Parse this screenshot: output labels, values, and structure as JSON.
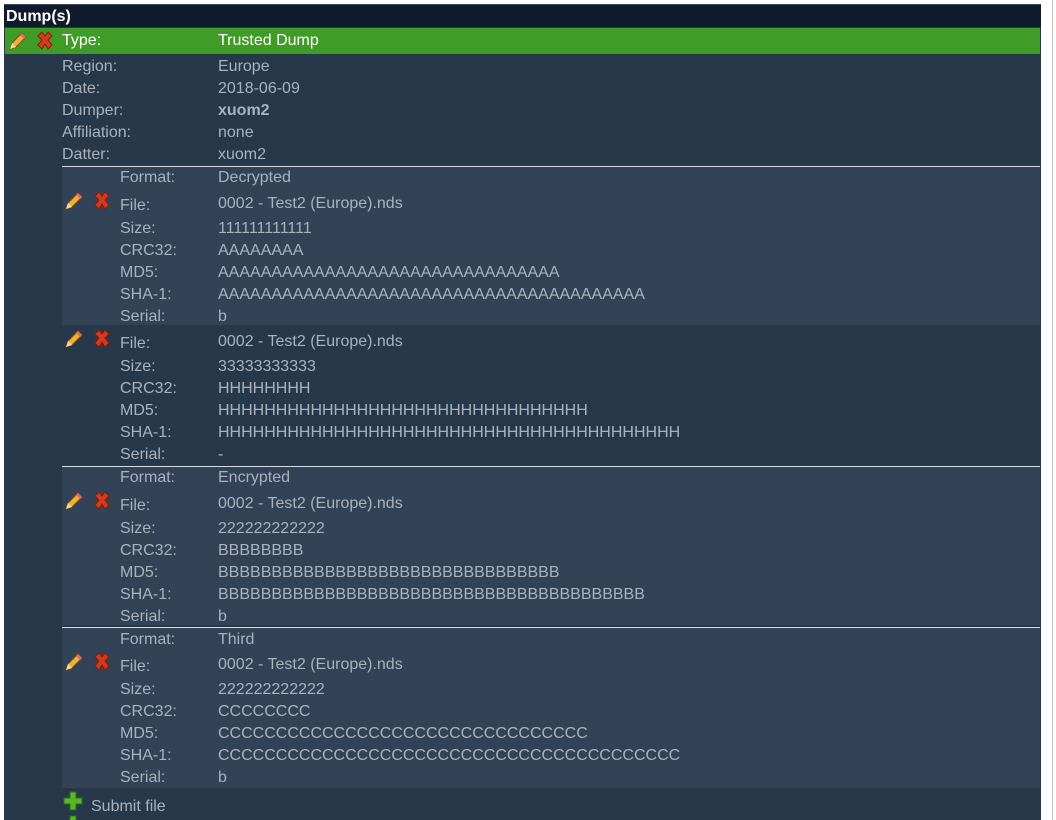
{
  "section_title": "Dump(s)",
  "dump": {
    "type_label": "Type:",
    "type_value": "Trusted Dump",
    "meta": [
      {
        "label": "Region:",
        "value": "Europe"
      },
      {
        "label": "Date:",
        "value": "2018-06-09"
      },
      {
        "label": "Dumper:",
        "value": "xuom2"
      },
      {
        "label": "Affiliation:",
        "value": "none"
      },
      {
        "label": "Datter:",
        "value": "xuom2"
      }
    ]
  },
  "groups": [
    {
      "format_label": "Format:",
      "format_value": "Decrypted",
      "files": [
        {
          "file_label": "File:",
          "file": "0002 - Test2 (Europe).nds",
          "size_label": "Size:",
          "size": "111111111111",
          "crc_label": "CRC32:",
          "crc32": "AAAAAAAA",
          "md5_label": "MD5:",
          "md5": "AAAAAAAAAAAAAAAAAAAAAAAAAAAAAAAA",
          "sha_label": "SHA-1:",
          "sha1": "AAAAAAAAAAAAAAAAAAAAAAAAAAAAAAAAAAAAAAAA",
          "serial_label": "Serial:",
          "serial": "b"
        },
        {
          "file_label": "File:",
          "file": "0002 - Test2 (Europe).nds",
          "size_label": "Size:",
          "size": "33333333333",
          "crc_label": "CRC32:",
          "crc32": "HHHHHHHH",
          "md5_label": "MD5:",
          "md5": "HHHHHHHHHHHHHHHHHHHHHHHHHHHHHHHH",
          "sha_label": "SHA-1:",
          "sha1": "HHHHHHHHHHHHHHHHHHHHHHHHHHHHHHHHHHHHHHHH",
          "serial_label": "Serial:",
          "serial": "-"
        }
      ]
    },
    {
      "format_label": "Format:",
      "format_value": "Encrypted",
      "files": [
        {
          "file_label": "File:",
          "file": "0002 - Test2 (Europe).nds",
          "size_label": "Size:",
          "size": "222222222222",
          "crc_label": "CRC32:",
          "crc32": "BBBBBBBB",
          "md5_label": "MD5:",
          "md5": "BBBBBBBBBBBBBBBBBBBBBBBBBBBBBBBB",
          "sha_label": "SHA-1:",
          "sha1": "BBBBBBBBBBBBBBBBBBBBBBBBBBBBBBBBBBBBBBBB",
          "serial_label": "Serial:",
          "serial": "b"
        }
      ]
    },
    {
      "format_label": "Format:",
      "format_value": "Third",
      "files": [
        {
          "file_label": "File:",
          "file": "0002 - Test2 (Europe).nds",
          "size_label": "Size:",
          "size": "222222222222",
          "crc_label": "CRC32:",
          "crc32": "CCCCCCCC",
          "md5_label": "MD5:",
          "md5": "CCCCCCCCCCCCCCCCCCCCCCCCCCCCCCCC",
          "sha_label": "SHA-1:",
          "sha1": "CCCCCCCCCCCCCCCCCCCCCCCCCCCCCCCCCCCCCCCC",
          "serial_label": "Serial:",
          "serial": "b"
        }
      ]
    }
  ],
  "submit_label": "Submit file",
  "icons": {
    "edit": "pencil-icon",
    "delete": "red-x-icon",
    "add": "green-plus-icon"
  }
}
